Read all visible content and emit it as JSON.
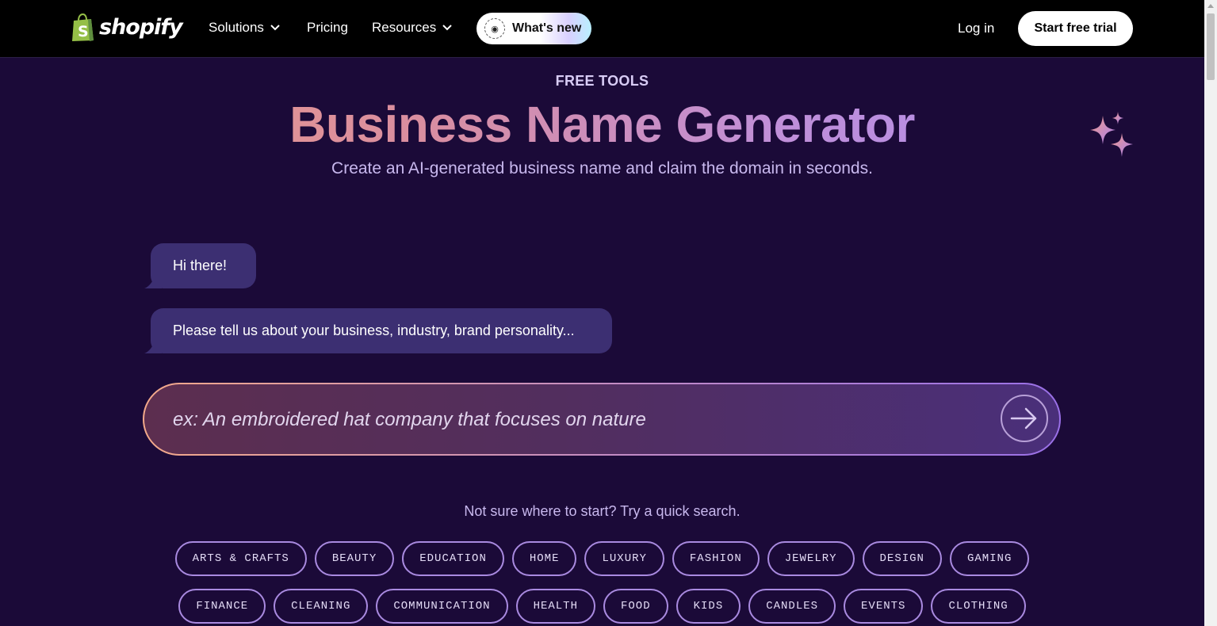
{
  "header": {
    "logo_text": "shopify",
    "nav": {
      "solutions": "Solutions",
      "pricing": "Pricing",
      "resources": "Resources",
      "whats_new": "What's new"
    },
    "login": "Log in",
    "start_trial": "Start free trial"
  },
  "hero": {
    "eyebrow": "FREE TOOLS",
    "title": "Business Name Generator",
    "subtitle": "Create an AI-generated business name and claim the domain in seconds."
  },
  "chat": {
    "greeting": "Hi there!",
    "prompt_message": "Please tell us about your business, industry, brand personality..."
  },
  "input": {
    "placeholder": "ex: An embroidered hat company that focuses on nature",
    "value": ""
  },
  "quick_search": {
    "label": "Not sure where to start? Try a quick search.",
    "row1": [
      "ARTS & CRAFTS",
      "BEAUTY",
      "EDUCATION",
      "HOME",
      "LUXURY",
      "FASHION",
      "JEWELRY",
      "DESIGN",
      "GAMING"
    ],
    "row2": [
      "FINANCE",
      "CLEANING",
      "COMMUNICATION",
      "HEALTH",
      "FOOD",
      "KIDS",
      "CANDLES",
      "EVENTS",
      "CLOTHING"
    ]
  },
  "colors": {
    "background": "#1b0a38",
    "header": "#000000",
    "bubble": "#3c2f72",
    "chip_border": "#a98ae0",
    "shopify_green": "#95bf47"
  }
}
